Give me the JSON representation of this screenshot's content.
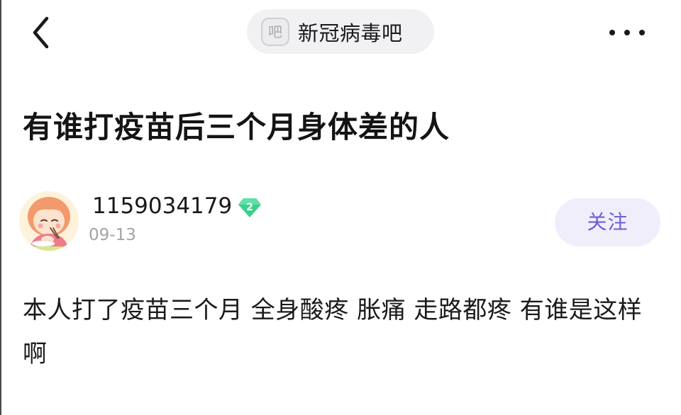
{
  "header": {
    "back_icon": "chevron-left-icon",
    "forum": {
      "icon_glyph": "吧",
      "name": "新冠病毒吧"
    },
    "more_icon": "more-dots-icon"
  },
  "post": {
    "title": "有谁打疫苗后三个月身体差的人",
    "author": {
      "name": "1159034179",
      "level": "2",
      "level_color": "#3ccf8e"
    },
    "date": "09-13",
    "follow_label": "关注",
    "follow_color": "#6b5fd6",
    "body": "本人打了疫苗三个月 全身酸疼 胀痛 走路都疼 有谁是这样啊"
  }
}
